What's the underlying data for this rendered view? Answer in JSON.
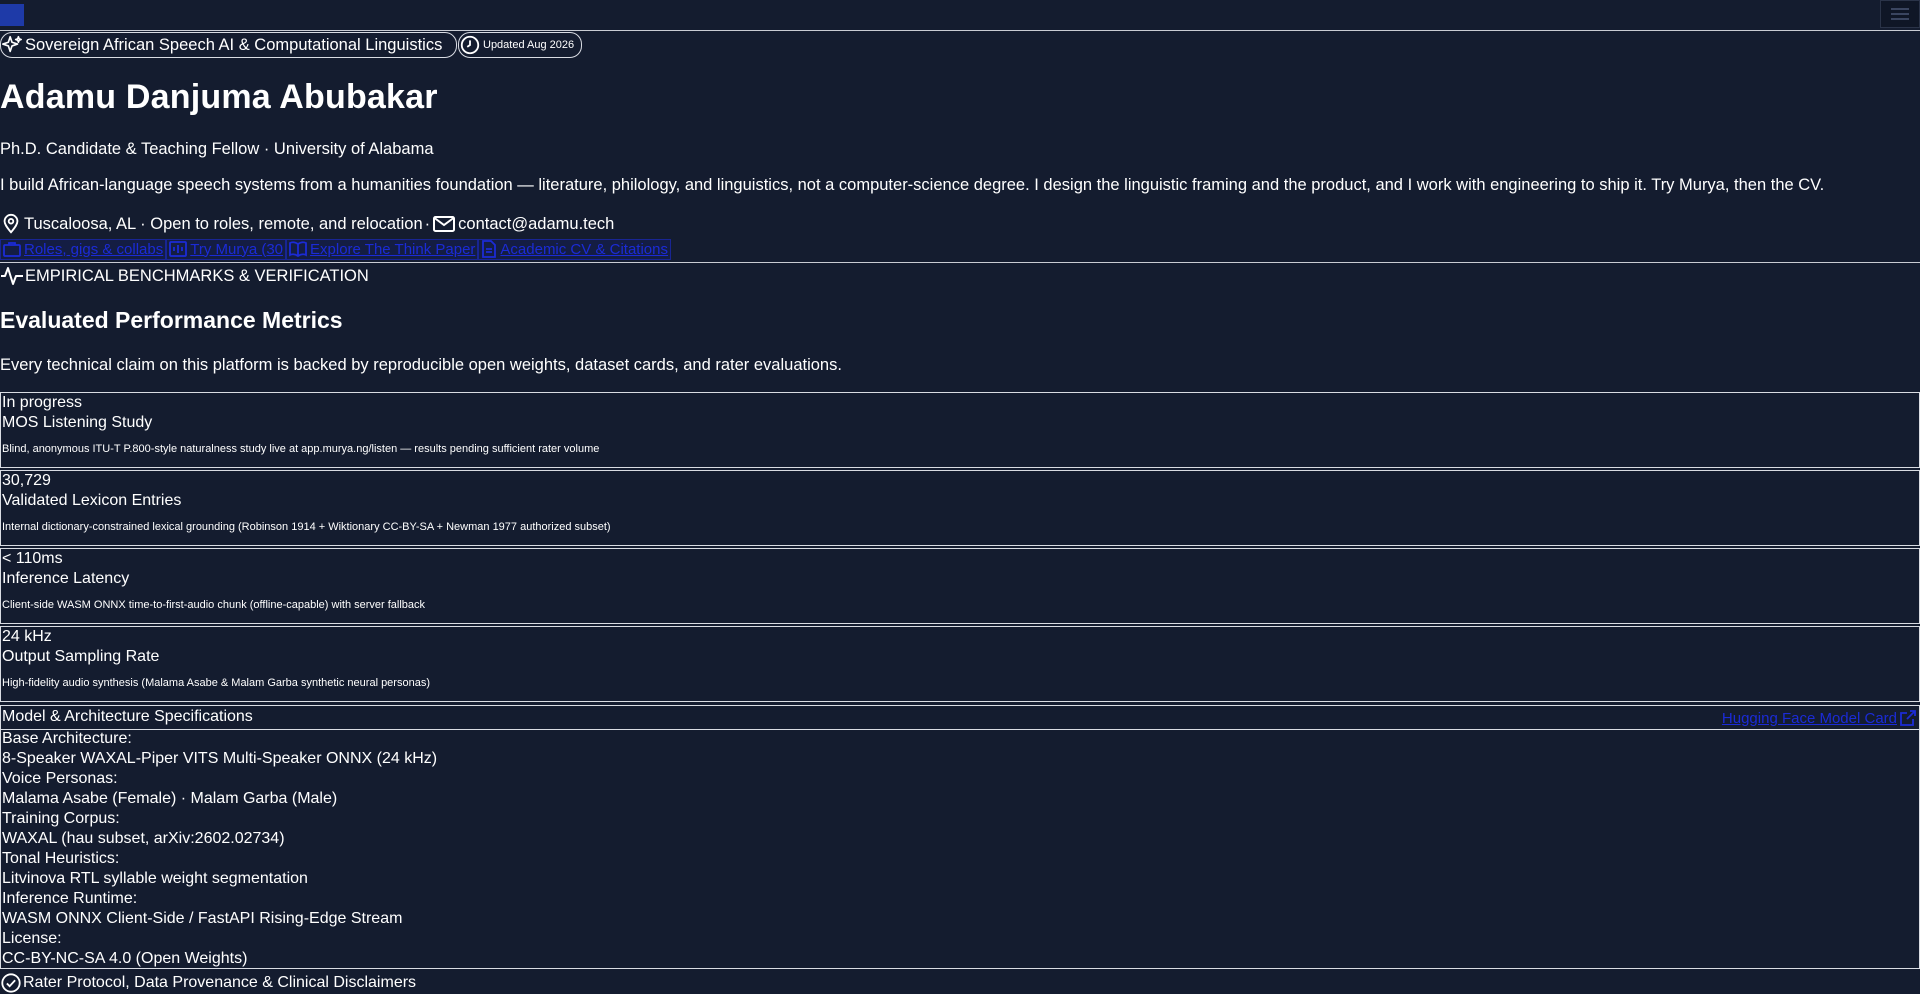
{
  "header": {
    "logo": "site-logo",
    "menu_icon": "menu-icon"
  },
  "hero": {
    "tag_label": "Sovereign African Speech AI & Computational Linguistics",
    "updated_label": "Updated Aug 2026",
    "name": "Adamu Danjuma Abubakar",
    "role": "Ph.D. Candidate & Teaching Fellow · University of Alabama",
    "bio": "I build African-language speech systems from a humanities foundation — literature, philology, and linguistics, not a computer-science degree. I design the linguistic framing and the product, and I work with engineering to ship it. Try Murya, then the CV.",
    "location": "Tuscaloosa, AL · Open to roles, remote, and relocation",
    "separator": "·",
    "email": "contact@adamu.tech",
    "links": [
      {
        "label": "Roles, gigs & collabs",
        "icon": "briefcase-icon"
      },
      {
        "label": "Try Murya (30",
        "icon": "audio-icon"
      },
      {
        "label": "Explore The Think Paper",
        "icon": "book-icon"
      },
      {
        "label": "Academic CV & Citations",
        "icon": "document-icon"
      }
    ]
  },
  "benchmarks": {
    "eyebrow": "EMPIRICAL BENCHMARKS & VERIFICATION",
    "title": "Evaluated Performance Metrics",
    "subtitle": "Every technical claim on this platform is backed by reproducible open weights, dataset cards, and rater evaluations.",
    "metrics": [
      {
        "value": "In progress",
        "title": "MOS Listening Study",
        "desc": "Blind, anonymous ITU-T P.800-style naturalness study live at app.murya.ng/listen — results pending sufficient rater volume"
      },
      {
        "value": "30,729",
        "title": "Validated Lexicon Entries",
        "desc": "Internal dictionary-constrained lexical grounding (Robinson 1914 + Wiktionary CC-BY-SA + Newman 1977 authorized subset)"
      },
      {
        "value": "< 110ms",
        "title": "Inference Latency",
        "desc": "Client-side WASM ONNX time-to-first-audio chunk (offline-capable) with server fallback"
      },
      {
        "value": "24 kHz",
        "title": "Output Sampling Rate",
        "desc": "High-fidelity audio synthesis (Malama Asabe & Malam Garba synthetic neural personas)"
      }
    ]
  },
  "specs": {
    "title": "Model & Architecture Specifications",
    "model_card_link": "Hugging Face Model Card",
    "rows": [
      {
        "label": "Base Architecture:",
        "value": "8-Speaker WAXAL-Piper VITS Multi-Speaker ONNX (24 kHz)"
      },
      {
        "label": "Voice Personas:",
        "value": "Malama Asabe (Female) · Malam Garba (Male)"
      },
      {
        "label": "Training Corpus:",
        "value": "WAXAL (hau subset, arXiv:2602.02734)"
      },
      {
        "label": "Tonal Heuristics:",
        "value": "Litvinova RTL syllable weight segmentation"
      },
      {
        "label": "Inference Runtime:",
        "value": "WASM ONNX Client-Side / FastAPI Rising-Edge Stream"
      },
      {
        "label": "License:",
        "value": "CC-BY-NC-SA 4.0 (Open Weights)"
      }
    ]
  },
  "disclaimers": {
    "title": "Rater Protocol, Data Provenance & Clinical Disclaimers"
  }
}
